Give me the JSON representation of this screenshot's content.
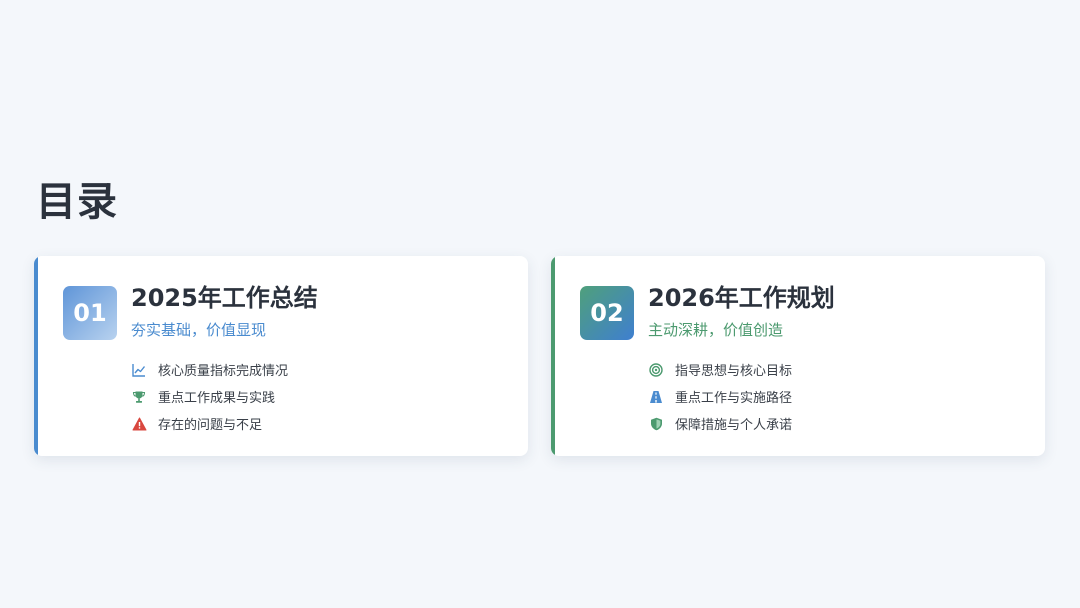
{
  "page": {
    "title": "目录"
  },
  "sections": [
    {
      "number": "01",
      "title": "2025年工作总结",
      "subtitle": "夯实基础，价值显现",
      "accent": "#4a8bcf",
      "items": [
        {
          "icon": "chart-line-icon",
          "label": "核心质量指标完成情况"
        },
        {
          "icon": "trophy-icon",
          "label": "重点工作成果与实践"
        },
        {
          "icon": "warning-triangle-icon",
          "label": "存在的问题与不足"
        }
      ]
    },
    {
      "number": "02",
      "title": "2026年工作规划",
      "subtitle": "主动深耕，价值创造",
      "accent": "#4c9a6f",
      "items": [
        {
          "icon": "target-icon",
          "label": "指导思想与核心目标"
        },
        {
          "icon": "road-icon",
          "label": "重点工作与实施路径"
        },
        {
          "icon": "shield-icon",
          "label": "保障措施与个人承诺"
        }
      ]
    }
  ],
  "colors": {
    "background": "#f4f7fb",
    "title_text": "#2b323d",
    "section_1_accent": "#4a8bcf",
    "section_2_accent": "#4c9a6f",
    "warning": "#d9473f"
  }
}
